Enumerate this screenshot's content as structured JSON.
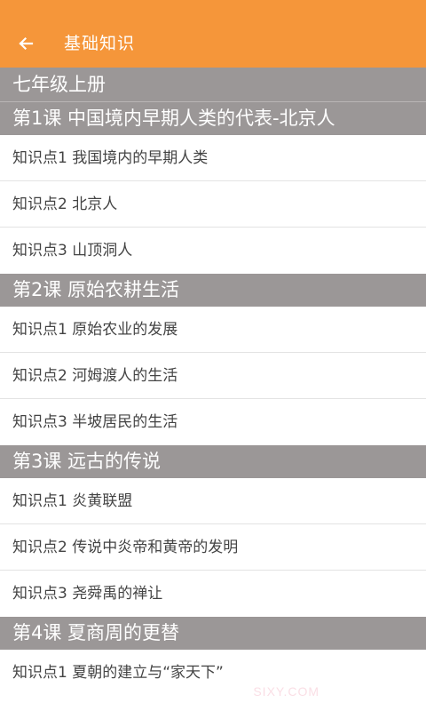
{
  "header": {
    "title": "基础知识",
    "back_icon": "arrow-left-icon"
  },
  "grade": "七年级上册",
  "lessons": [
    {
      "title": "第1课 中国境内早期人类的代表-北京人",
      "points": [
        "知识点1 我国境内的早期人类",
        "知识点2 北京人",
        "知识点3 山顶洞人"
      ]
    },
    {
      "title": "第2课 原始农耕生活",
      "points": [
        "知识点1 原始农业的发展",
        "知识点2 河姆渡人的生活",
        "知识点3 半坡居民的生活"
      ]
    },
    {
      "title": "第3课 远古的传说",
      "points": [
        "知识点1 炎黄联盟",
        "知识点2 传说中炎帝和黄帝的发明",
        "知识点3 尧舜禹的禅让"
      ]
    },
    {
      "title": "第4课 夏商周的更替",
      "points": [
        "知识点1 夏朝的建立与“家天下”"
      ]
    }
  ],
  "watermark": "SIXY.COM",
  "colors": {
    "appbar": "#f5963a",
    "section_header": "#9b9797"
  }
}
